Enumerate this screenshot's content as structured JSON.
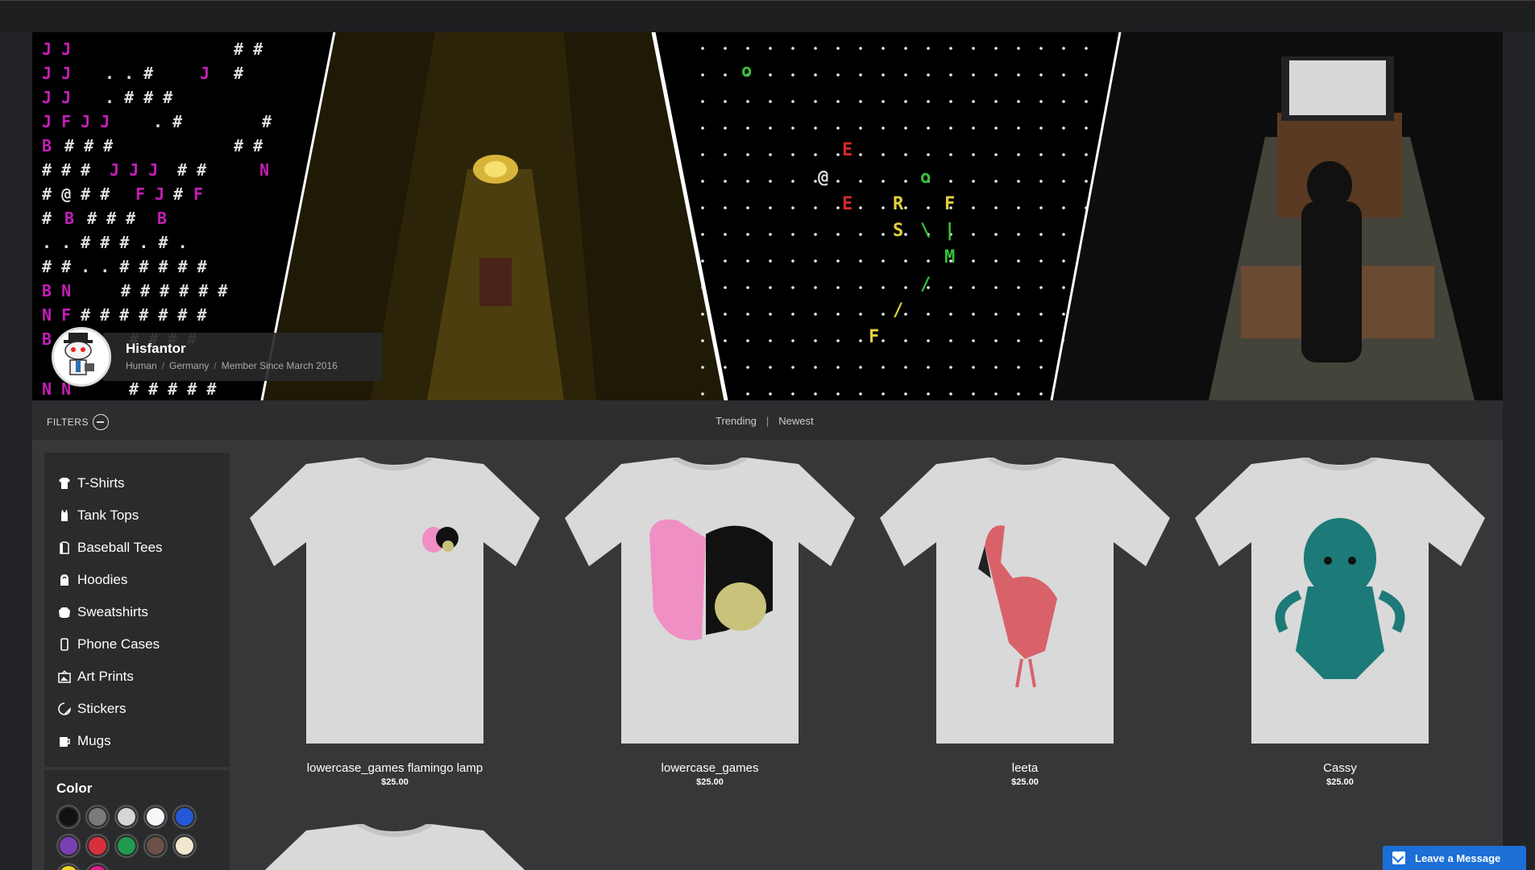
{
  "profile": {
    "username": "Hisfantor",
    "meta": [
      "Human",
      "Germany",
      "Member Since March 2016"
    ]
  },
  "filterbar": {
    "filters_label": "FILTERS",
    "sort_options": [
      "Trending",
      "Newest"
    ]
  },
  "sidebar": {
    "categories": [
      {
        "label": "T-Shirts",
        "icon": "tshirt-icon"
      },
      {
        "label": "Tank Tops",
        "icon": "tank-top-icon"
      },
      {
        "label": "Baseball Tees",
        "icon": "baseball-tee-icon"
      },
      {
        "label": "Hoodies",
        "icon": "hoodie-icon"
      },
      {
        "label": "Sweatshirts",
        "icon": "sweatshirt-icon"
      },
      {
        "label": "Phone Cases",
        "icon": "phone-case-icon"
      },
      {
        "label": "Art Prints",
        "icon": "art-print-icon"
      },
      {
        "label": "Stickers",
        "icon": "sticker-icon"
      },
      {
        "label": "Mugs",
        "icon": "mug-icon"
      }
    ],
    "color_label": "Color",
    "colors": [
      "#111111",
      "#7a7a7a",
      "#d6d6d6",
      "#f7f7f7",
      "#2358d6",
      "#7a3fb0",
      "#d8303a",
      "#1f9a4e",
      "#6a5046",
      "#efe8cf",
      "#f2d62a",
      "#e21e8a"
    ]
  },
  "products": [
    {
      "name": "lowercase_games flamingo lamp",
      "price": "$25.00"
    },
    {
      "name": "lowercase_games",
      "price": "$25.00"
    },
    {
      "name": "leeta",
      "price": "$25.00"
    },
    {
      "name": "Cassy",
      "price": "$25.00"
    }
  ],
  "chat": {
    "label": "Leave a Message"
  }
}
